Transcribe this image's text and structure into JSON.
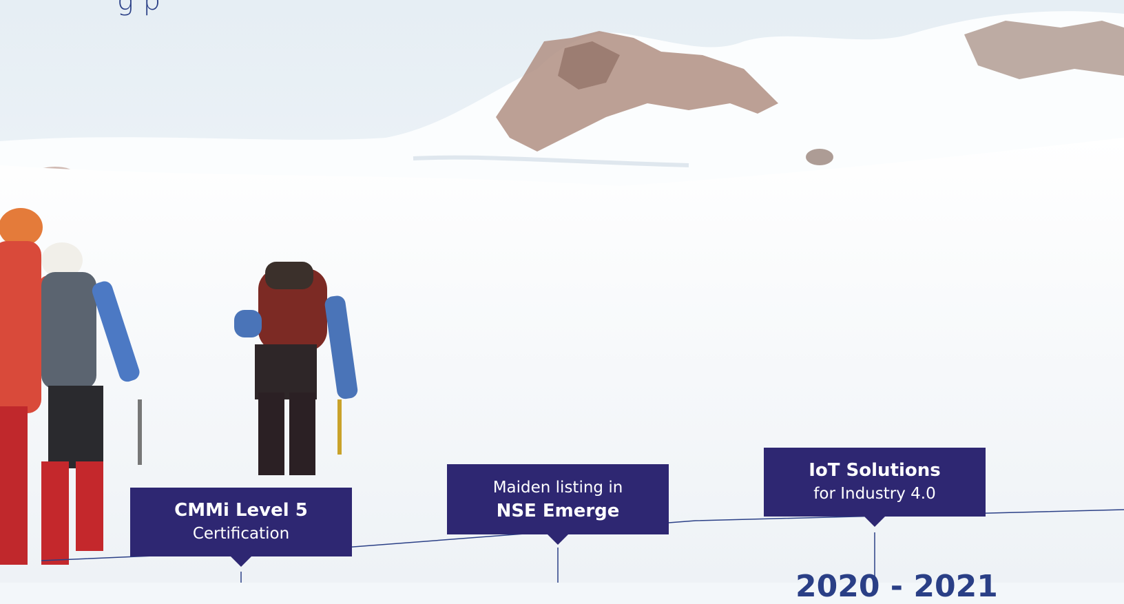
{
  "heading": "g    p",
  "milestones": [
    {
      "bold": "CMMi Level 5",
      "light": "Certification",
      "order": "bold-first"
    },
    {
      "light": "Maiden listing in",
      "bold": "NSE Emerge",
      "order": "light-first"
    },
    {
      "bold": "IoT Solutions",
      "light": "for Industry 4.0",
      "order": "bold-first"
    }
  ],
  "year_label": "2020 - 2021",
  "colors": {
    "callout": "#2e2772",
    "timeline": "#2a3f86",
    "snow": "#f3f7fa"
  }
}
